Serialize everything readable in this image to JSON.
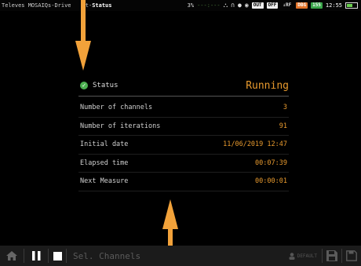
{
  "status_bar": {
    "app_title_prefix": "Televes MOSAIQ",
    "app_title_fragment": "s-Drive",
    "app_title_fragment2": "st-",
    "app_title_section": "Status",
    "cpu_percent": "3%",
    "cpu_graph": "---:---",
    "output_tag": "OUT",
    "off_tag": "OFF",
    "rf_tag": "↓RF",
    "dbg_tag": "DBG",
    "count_tag": "155",
    "time": "12:55"
  },
  "panel": {
    "header_label": "Status",
    "header_value": "Running",
    "rows": [
      {
        "label": "Number of channels",
        "value": "3"
      },
      {
        "label": "Number of iterations",
        "value": "91"
      },
      {
        "label": "Initial date",
        "value": "11/06/2019 12:47"
      },
      {
        "label": "Elapsed time",
        "value": "00:07:39"
      },
      {
        "label": "Next Measure",
        "value": "00:00:01"
      }
    ]
  },
  "toolbar": {
    "sel_channels_label": "Sel. Channels",
    "default_label": "DEFAULT"
  },
  "colors": {
    "accent_orange": "#e89a2e",
    "arrow_orange": "#f2a23a",
    "status_green": "#4caf50"
  },
  "icons": [
    "home-icon",
    "pause-icon",
    "stop-icon",
    "user-icon",
    "save-icon",
    "save-as-icon",
    "check-icon",
    "battery-icon",
    "gps-icon",
    "headphones-icon",
    "location-icon",
    "signal-icon"
  ]
}
